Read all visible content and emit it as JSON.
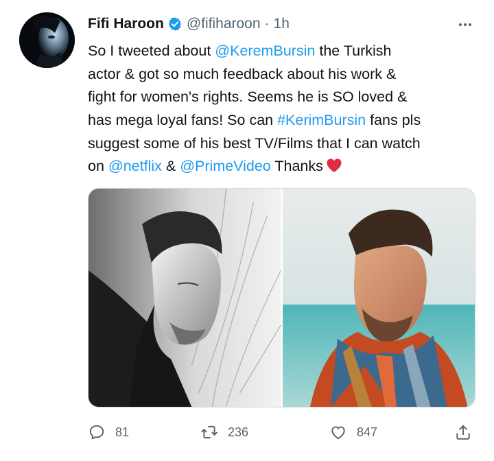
{
  "author": {
    "display_name": "Fifi Haroon",
    "handle": "@fifiharoon",
    "separator": "·",
    "time": "1h",
    "verified": true
  },
  "tweet": {
    "lines": [
      [
        {
          "text": "So  I tweeted about ",
          "link": false
        },
        {
          "text": "@KeremBursin",
          "link": true
        },
        {
          "text": " the Turkish",
          "link": false
        }
      ],
      [
        {
          "text": "actor  & got so much feedback about his work &",
          "link": false
        }
      ],
      [
        {
          "text": "fight for women's rights. Seems he is SO loved &",
          "link": false
        }
      ],
      [
        {
          "text": "has mega loyal fans! So can ",
          "link": false
        },
        {
          "text": "#KerimBursin",
          "link": true
        },
        {
          "text": " fans pls",
          "link": false
        }
      ],
      [
        {
          "text": "suggest some of his best TV/Films that I can watch",
          "link": false
        }
      ],
      [
        {
          "text": "on ",
          "link": false
        },
        {
          "text": "@netflix",
          "link": true
        },
        {
          "text": "  & ",
          "link": false
        },
        {
          "text": "@PrimeVideo",
          "link": true
        },
        {
          "text": "  Thanks",
          "link": false
        }
      ]
    ],
    "emoji": "red-heart"
  },
  "media": [
    {
      "name": "media-photo-black-white-portrait"
    },
    {
      "name": "media-photo-color-portrait-beach"
    }
  ],
  "actions": {
    "reply": {
      "icon": "reply-icon",
      "count": "81"
    },
    "retweet": {
      "icon": "retweet-icon",
      "count": "236"
    },
    "like": {
      "icon": "heart-outline-icon",
      "count": "847"
    },
    "share": {
      "icon": "share-icon"
    }
  },
  "colors": {
    "link": "#1d9bf0",
    "text": "#0f1419",
    "secondary": "#536471",
    "verified": "#1d9bf0",
    "heart_emoji": "#dd2e44",
    "border": "#cfd9de"
  }
}
